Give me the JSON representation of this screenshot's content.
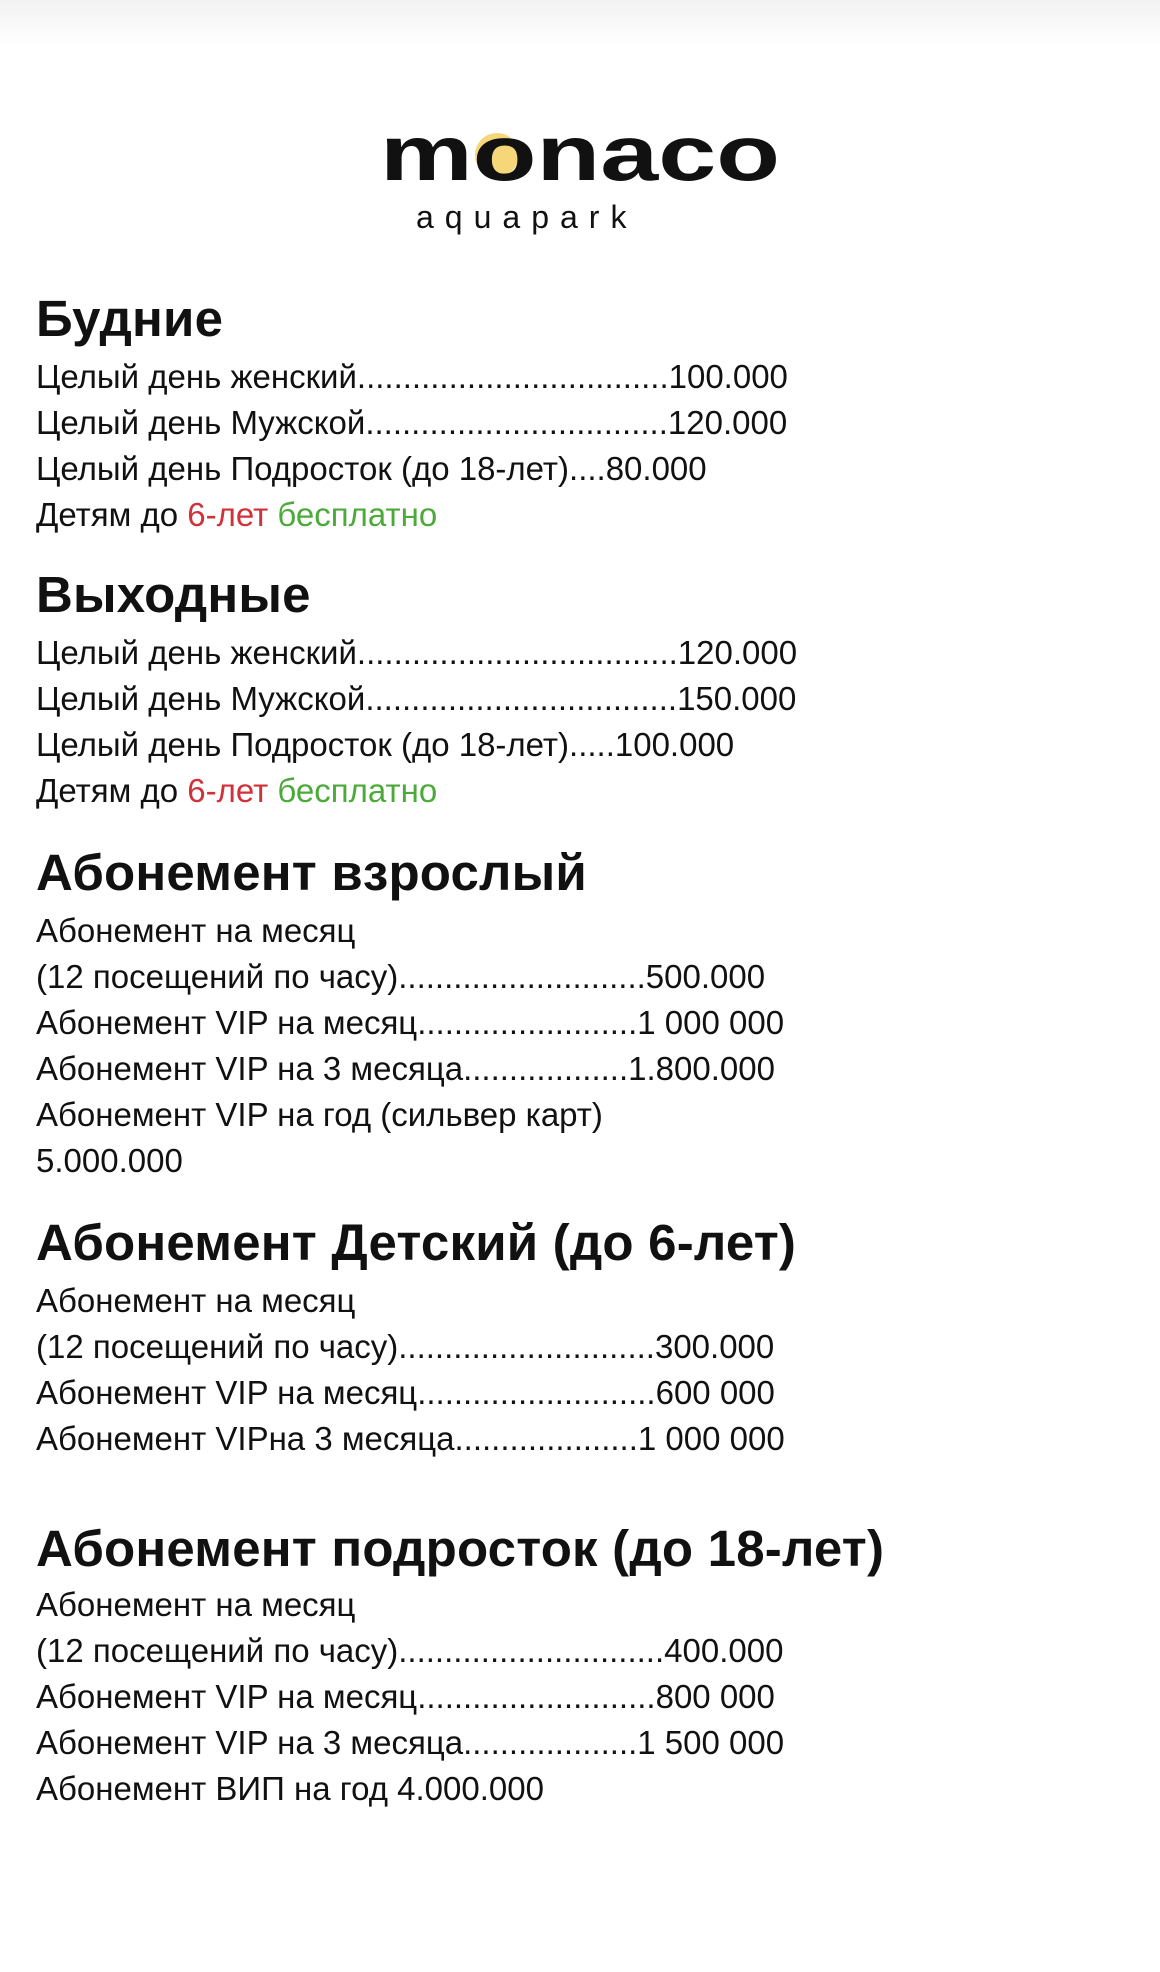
{
  "header": {
    "brand": "monaco",
    "sub": "aquapark"
  },
  "colors": {
    "accent_red": "#d0323a",
    "accent_green": "#4caa3a",
    "logo_sun": "#f5d77a",
    "logo_water": "#9fd3ee"
  },
  "sections": [
    {
      "title": "Будние",
      "lines": [
        "Целый день женский..................................100.000",
        "Целый день Мужской.................................120.000",
        "Целый день Подросток (до 18-лет)....80.000"
      ],
      "kids": {
        "prefix": "Детям до ",
        "age": "6-лет",
        "free": " бесплатно"
      }
    },
    {
      "title": "Выходные",
      "lines": [
        "Целый день женский...................................120.000",
        "Целый день Мужской..................................150.000",
        "Целый день Подросток (до 18-лет).....100.000"
      ],
      "kids": {
        "prefix": "Детям до ",
        "age": "6-лет",
        "free": " бесплатно"
      }
    },
    {
      "title": "Абонемент взрослый",
      "lines": [
        "Абонемент на месяц",
        "(12 посещений по часу)...........................500.000",
        "Абонемент VIP на месяц........................1 000 000",
        "Абонемент VIP на 3 месяца..................1.800.000",
        "Абонемент VIP на год (сильвер карт)",
        "5.000.000"
      ]
    },
    {
      "title": "Абонемент Детский (до 6-лет)",
      "lines": [
        "Абонемент на месяц",
        "(12 посещений по часу)............................300.000",
        "Абонемент VIP на месяц..........................600 000",
        "Абонемент VIPна 3 месяца....................1 000 000"
      ]
    },
    {
      "title": "Абонемент подросток (до 18-лет)",
      "lines": [
        "Абонемент на месяц",
        "(12 посещений по часу).............................400.000",
        "Абонемент VIP на месяц..........................800 000",
        "Абонемент VIP на 3 месяца...................1 500 000",
        "Абонемент ВИП на год 4.000.000"
      ]
    }
  ]
}
